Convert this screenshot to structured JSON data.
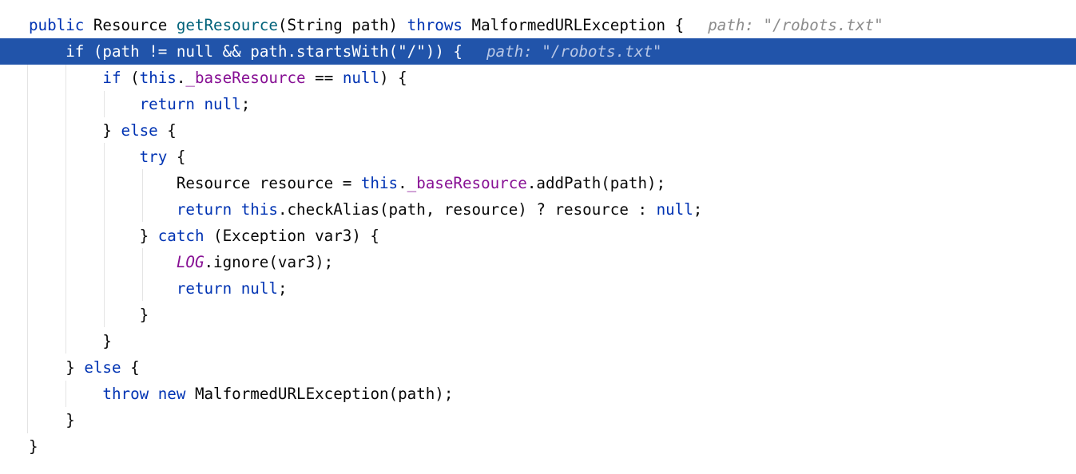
{
  "editor": {
    "language": "java",
    "current_line_index": 1,
    "inline_hint_text": "path: \"/robots.txt\"",
    "colors": {
      "keyword": "#0033b3",
      "method": "#00627a",
      "field": "#871094",
      "text": "#080808",
      "hint": "#8c8c8c",
      "current_line_bg": "#2154aa",
      "intention_bulb": "#f2b600"
    },
    "icons": {
      "intention": "lightbulb-icon"
    },
    "lines": [
      {
        "tokens": [
          {
            "t": "public",
            "c": "kw"
          },
          {
            "t": " Resource ",
            "c": "txt"
          },
          {
            "t": "getResource",
            "c": "fn"
          },
          {
            "t": "(String path) ",
            "c": "txt"
          },
          {
            "t": "throws",
            "c": "kw"
          },
          {
            "t": " MalformedURLException {",
            "c": "txt"
          }
        ],
        "hint": "path: \"/robots.txt\""
      },
      {
        "tokens": [
          {
            "t": "    ",
            "c": "txt"
          },
          {
            "t": "if",
            "c": "kw"
          },
          {
            "t": " (path != ",
            "c": "txt"
          },
          {
            "t": "null",
            "c": "kw"
          },
          {
            "t": " && path.startsWith(\"/\")) {",
            "c": "txt"
          }
        ],
        "hint": "path: \"/robots.txt\""
      },
      {
        "tokens": [
          {
            "t": "        ",
            "c": "txt"
          },
          {
            "t": "if",
            "c": "kw"
          },
          {
            "t": " (",
            "c": "txt"
          },
          {
            "t": "this",
            "c": "kw"
          },
          {
            "t": ".",
            "c": "txt"
          },
          {
            "t": "_baseResource",
            "c": "fld"
          },
          {
            "t": " == ",
            "c": "txt"
          },
          {
            "t": "null",
            "c": "kw"
          },
          {
            "t": ") {",
            "c": "txt"
          }
        ]
      },
      {
        "tokens": [
          {
            "t": "            ",
            "c": "txt"
          },
          {
            "t": "return",
            "c": "kw"
          },
          {
            "t": " ",
            "c": "txt"
          },
          {
            "t": "null",
            "c": "kw"
          },
          {
            "t": ";",
            "c": "txt"
          }
        ]
      },
      {
        "tokens": [
          {
            "t": "        } ",
            "c": "txt"
          },
          {
            "t": "else",
            "c": "kw"
          },
          {
            "t": " {",
            "c": "txt"
          }
        ]
      },
      {
        "tokens": [
          {
            "t": "            ",
            "c": "txt"
          },
          {
            "t": "try",
            "c": "kw"
          },
          {
            "t": " {",
            "c": "txt"
          }
        ]
      },
      {
        "tokens": [
          {
            "t": "                Resource resource = ",
            "c": "txt"
          },
          {
            "t": "this",
            "c": "kw"
          },
          {
            "t": ".",
            "c": "txt"
          },
          {
            "t": "_baseResource",
            "c": "fld"
          },
          {
            "t": ".addPath(path);",
            "c": "txt"
          }
        ]
      },
      {
        "tokens": [
          {
            "t": "                ",
            "c": "txt"
          },
          {
            "t": "return",
            "c": "kw"
          },
          {
            "t": " ",
            "c": "txt"
          },
          {
            "t": "this",
            "c": "kw"
          },
          {
            "t": ".checkAlias(path, resource) ? resource : ",
            "c": "txt"
          },
          {
            "t": "null",
            "c": "kw"
          },
          {
            "t": ";",
            "c": "txt"
          }
        ]
      },
      {
        "tokens": [
          {
            "t": "            } ",
            "c": "txt"
          },
          {
            "t": "catch",
            "c": "kw"
          },
          {
            "t": " (Exception var3) {",
            "c": "txt"
          }
        ]
      },
      {
        "tokens": [
          {
            "t": "                ",
            "c": "txt"
          },
          {
            "t": "LOG",
            "c": "cst"
          },
          {
            "t": ".ignore(var3);",
            "c": "txt"
          }
        ]
      },
      {
        "tokens": [
          {
            "t": "                ",
            "c": "txt"
          },
          {
            "t": "return",
            "c": "kw"
          },
          {
            "t": " ",
            "c": "txt"
          },
          {
            "t": "null",
            "c": "kw"
          },
          {
            "t": ";",
            "c": "txt"
          }
        ]
      },
      {
        "tokens": [
          {
            "t": "            }",
            "c": "txt"
          }
        ]
      },
      {
        "tokens": [
          {
            "t": "        }",
            "c": "txt"
          }
        ]
      },
      {
        "tokens": [
          {
            "t": "    } ",
            "c": "txt"
          },
          {
            "t": "else",
            "c": "kw"
          },
          {
            "t": " {",
            "c": "txt"
          }
        ]
      },
      {
        "tokens": [
          {
            "t": "        ",
            "c": "txt"
          },
          {
            "t": "throw",
            "c": "kw"
          },
          {
            "t": " ",
            "c": "txt"
          },
          {
            "t": "new",
            "c": "kw"
          },
          {
            "t": " MalformedURLException(path);",
            "c": "txt"
          }
        ]
      },
      {
        "tokens": [
          {
            "t": "    }",
            "c": "txt"
          }
        ]
      },
      {
        "tokens": [
          {
            "t": "}",
            "c": "txt"
          }
        ]
      }
    ]
  }
}
